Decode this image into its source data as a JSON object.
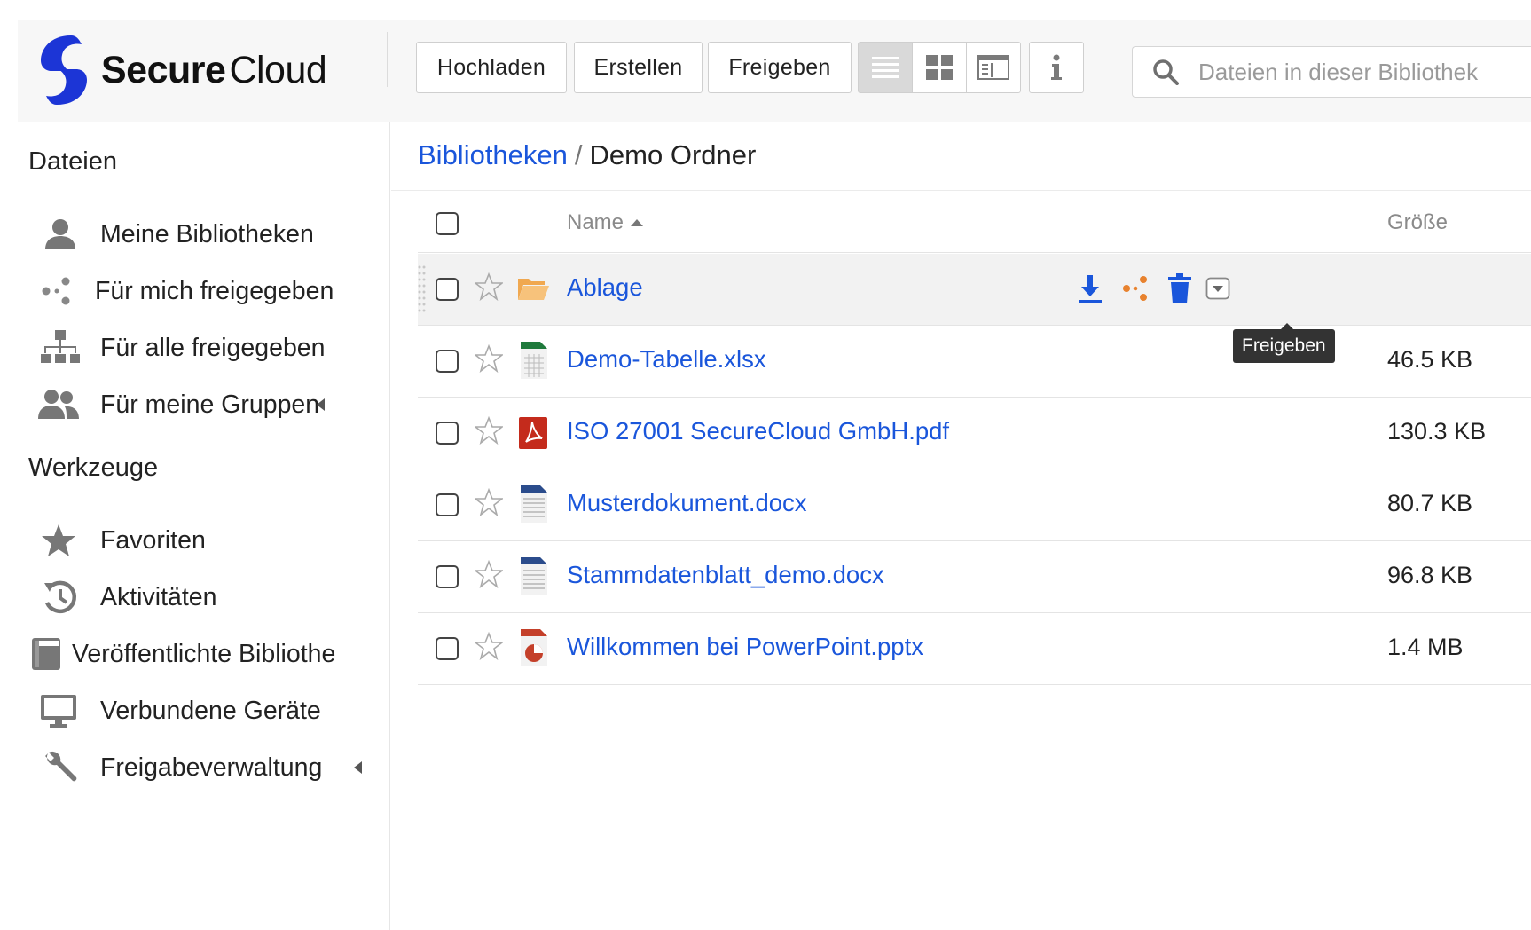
{
  "app": {
    "logo_secure": "Secure",
    "logo_cloud": "Cloud",
    "brand_color": "#1c35d6"
  },
  "toolbar": {
    "upload_label": "Hochladen",
    "create_label": "Erstellen",
    "share_label": "Freigeben",
    "view_modes": [
      "list-view-icon",
      "grid-view-icon",
      "detail-view-icon"
    ],
    "active_view": "list",
    "info_icon": "info-icon"
  },
  "search": {
    "placeholder": "Dateien in dieser Bibliothek"
  },
  "sidebar": {
    "files_heading": "Dateien",
    "files_items": [
      {
        "label": "Meine Bibliotheken",
        "icon": "user-icon"
      },
      {
        "label": "Für mich freigegeben",
        "icon": "share-icon"
      },
      {
        "label": "Für alle freigegeben",
        "icon": "org-chart-icon"
      },
      {
        "label": "Für meine Gruppen",
        "icon": "group-icon"
      }
    ],
    "tools_heading": "Werkzeuge",
    "tools_items": [
      {
        "label": "Favoriten",
        "icon": "star-icon"
      },
      {
        "label": "Aktivitäten",
        "icon": "history-icon"
      },
      {
        "label": "Veröffentlichte Bibliothe",
        "icon": "book-icon"
      },
      {
        "label": "Verbundene Geräte",
        "icon": "monitor-icon"
      },
      {
        "label": "Freigabeverwaltung",
        "icon": "wrench-icon"
      }
    ]
  },
  "breadcrumb": {
    "root": "Bibliotheken",
    "separator": "/",
    "current": "Demo Ordner"
  },
  "table": {
    "col_name": "Name",
    "col_size": "Größe",
    "sort": "name-ascending",
    "rows": [
      {
        "name": "Ablage",
        "size": "",
        "type": "folder"
      },
      {
        "name": "Demo-Tabelle.xlsx",
        "size": "46.5 KB",
        "type": "xlsx"
      },
      {
        "name": "ISO 27001 SecureCloud GmbH.pdf",
        "size": "130.3 KB",
        "type": "pdf"
      },
      {
        "name": "Musterdokument.docx",
        "size": "80.7 KB",
        "type": "docx"
      },
      {
        "name": "Stammdatenblatt_demo.docx",
        "size": "96.8 KB",
        "type": "docx"
      },
      {
        "name": "Willkommen bei PowerPoint.pptx",
        "size": "1.4 MB",
        "type": "pptx"
      }
    ]
  },
  "row_actions": {
    "icons": [
      "download-icon",
      "share-icon",
      "trash-icon",
      "dropdown-icon"
    ],
    "tooltip": "Freigeben"
  },
  "colors": {
    "link": "#1a56db",
    "share_orange": "#e8822e",
    "folder": "#f5b866"
  }
}
